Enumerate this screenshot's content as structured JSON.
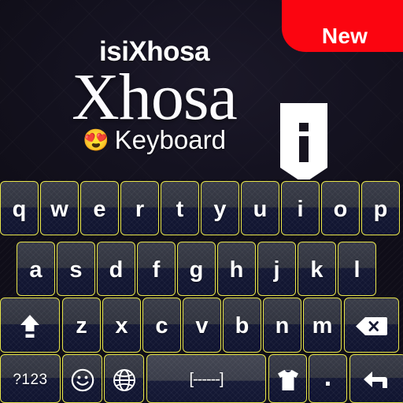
{
  "app": {
    "name": "isiXhosa Xhosa Keyboard",
    "badge_label": "New",
    "badge_color": "#fb0510",
    "background_color": "#14121d",
    "key_border_color": "#e8e54a"
  },
  "hero": {
    "subtitle_top": "isiXhosa",
    "title_main": "Xhosa",
    "emoji": "😍",
    "subtitle_bottom": "Keyboard",
    "logo_icon": "shield-info-icon",
    "logo_letter": "i"
  },
  "keyboard": {
    "layout": "qwerty",
    "rows": [
      {
        "name": "row-1",
        "keys": [
          {
            "label": "q",
            "name": "key-q"
          },
          {
            "label": "w",
            "name": "key-w"
          },
          {
            "label": "e",
            "name": "key-e"
          },
          {
            "label": "r",
            "name": "key-r"
          },
          {
            "label": "t",
            "name": "key-t"
          },
          {
            "label": "y",
            "name": "key-y"
          },
          {
            "label": "u",
            "name": "key-u"
          },
          {
            "label": "i",
            "name": "key-i"
          },
          {
            "label": "o",
            "name": "key-o"
          },
          {
            "label": "p",
            "name": "key-p"
          }
        ]
      },
      {
        "name": "row-2",
        "keys": [
          {
            "label": "a",
            "name": "key-a"
          },
          {
            "label": "s",
            "name": "key-s"
          },
          {
            "label": "d",
            "name": "key-d"
          },
          {
            "label": "f",
            "name": "key-f"
          },
          {
            "label": "g",
            "name": "key-g"
          },
          {
            "label": "h",
            "name": "key-h"
          },
          {
            "label": "j",
            "name": "key-j"
          },
          {
            "label": "k",
            "name": "key-k"
          },
          {
            "label": "l",
            "name": "key-l"
          }
        ]
      },
      {
        "name": "row-3",
        "keys": [
          {
            "label": "",
            "name": "key-shift",
            "icon": "shift-arrow-icon"
          },
          {
            "label": "z",
            "name": "key-z"
          },
          {
            "label": "x",
            "name": "key-x"
          },
          {
            "label": "c",
            "name": "key-c"
          },
          {
            "label": "v",
            "name": "key-v"
          },
          {
            "label": "b",
            "name": "key-b"
          },
          {
            "label": "n",
            "name": "key-n"
          },
          {
            "label": "m",
            "name": "key-m"
          },
          {
            "label": "",
            "name": "key-backspace",
            "icon": "backspace-icon"
          }
        ]
      },
      {
        "name": "row-4",
        "keys": [
          {
            "label": "?123",
            "name": "key-symbols"
          },
          {
            "label": "",
            "name": "key-emoji",
            "icon": "smiley-face-icon"
          },
          {
            "label": "",
            "name": "key-language",
            "icon": "globe-icon"
          },
          {
            "label": "[------]",
            "name": "key-space"
          },
          {
            "label": "",
            "name": "key-theme",
            "icon": "t-shirt-icon"
          },
          {
            "label": ".",
            "name": "key-period"
          },
          {
            "label": "",
            "name": "key-enter",
            "icon": "enter-arrow-icon"
          }
        ]
      }
    ]
  }
}
